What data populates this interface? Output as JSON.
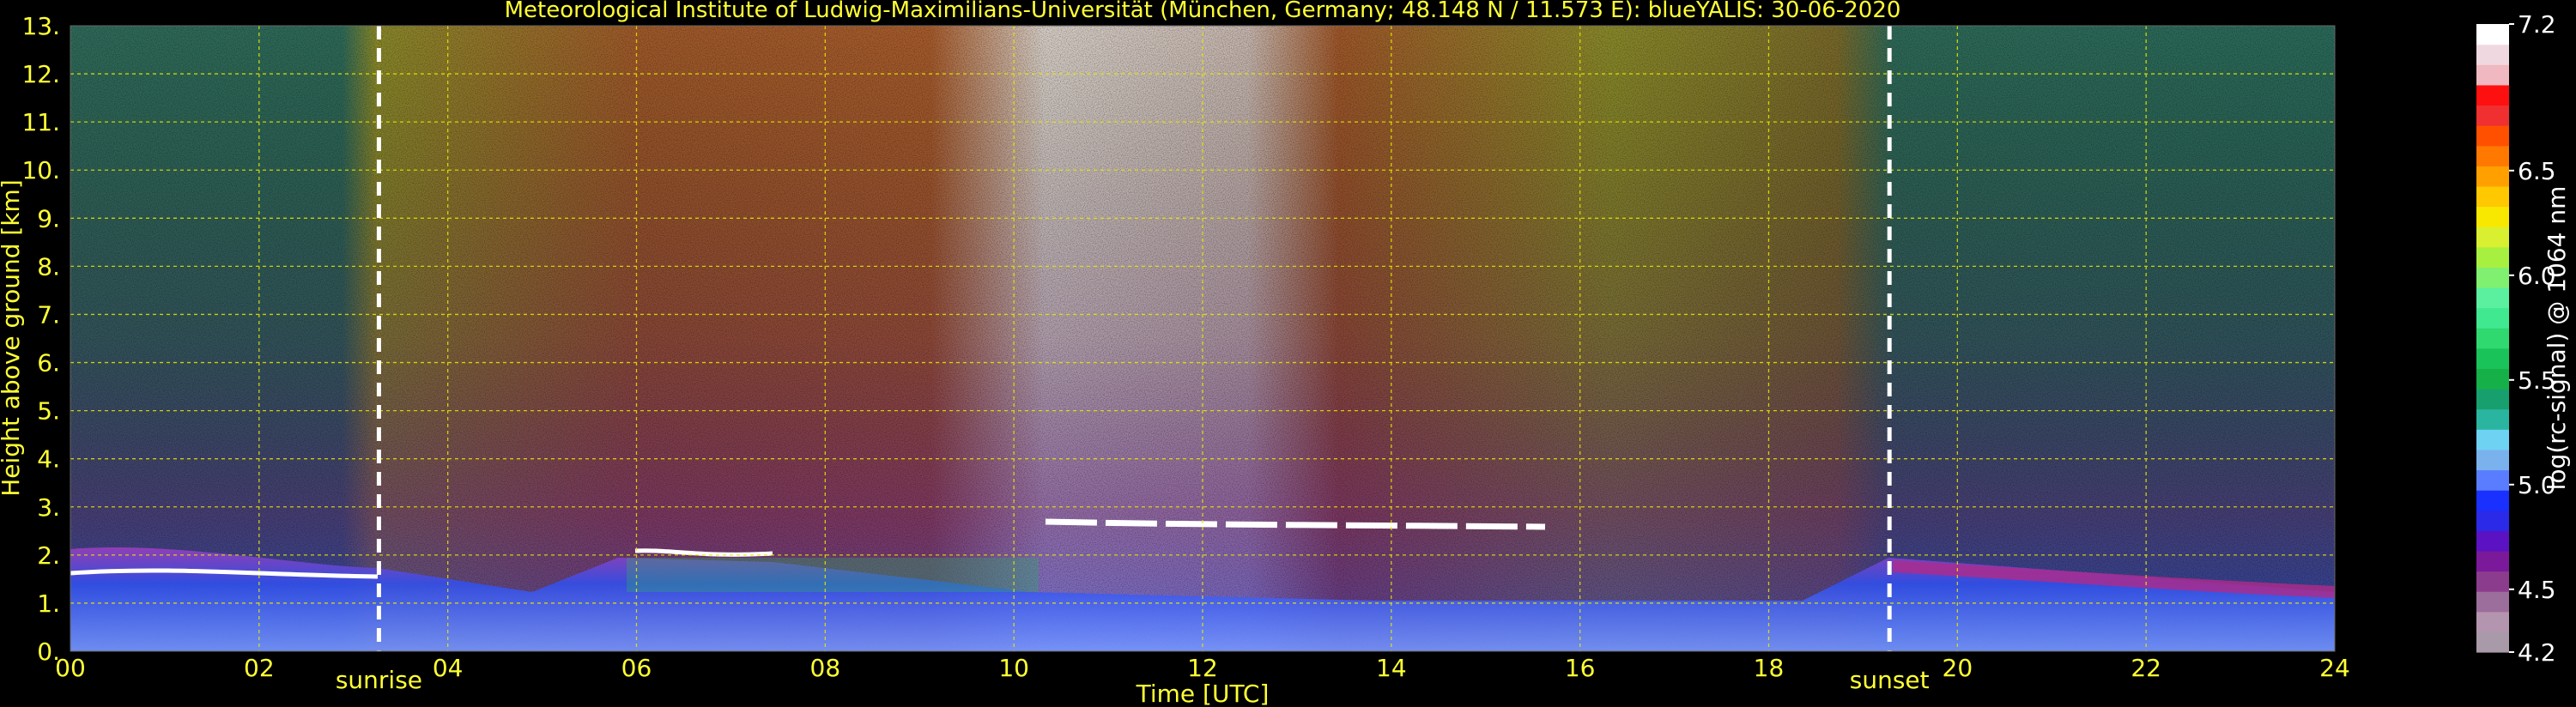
{
  "chart_data": {
    "type": "heatmap",
    "title": "Meteorological Institute of Ludwig-Maximilians-Universität (München, Germany; 48.148 N / 11.573 E):    blueYALIS: 30-06-2020",
    "xlabel": "Time [UTC]",
    "ylabel": "Height above ground [km]",
    "xlim": [
      0,
      24
    ],
    "ylim": [
      0,
      13
    ],
    "x_ticks": [
      "00",
      "02",
      "04",
      "06",
      "08",
      "10",
      "12",
      "14",
      "16",
      "18",
      "20",
      "22",
      "24"
    ],
    "y_ticks": [
      "0.",
      "1.",
      "2.",
      "3.",
      "4.",
      "5.",
      "6.",
      "7.",
      "8.",
      "9.",
      "10.",
      "11.",
      "12.",
      "13."
    ],
    "grid": true,
    "vlines": [
      {
        "x": 3.27,
        "label": "sunrise"
      },
      {
        "x": 19.28,
        "label": "sunset"
      }
    ],
    "colorbar": {
      "label": "log(rc-signal) @ 1064 nm",
      "range": [
        4.2,
        7.2
      ],
      "ticks": [
        "4.2",
        "4.5",
        "5.0",
        "5.5",
        "6.0",
        "6.5",
        "7.2"
      ],
      "colors": [
        "#a89aa8",
        "#b495b0",
        "#9c6e9c",
        "#8c3c8c",
        "#7a1a9a",
        "#5a12c2",
        "#2a2ae8",
        "#1a30ff",
        "#5a7dff",
        "#7ab2ee",
        "#6ed2f2",
        "#2ab5a0",
        "#17a06e",
        "#16b048",
        "#1ac25a",
        "#30d870",
        "#40e890",
        "#5af0a0",
        "#80f070",
        "#a8f040",
        "#d8f030",
        "#f8e800",
        "#ffc800",
        "#ffa000",
        "#ff7800",
        "#ff5000",
        "#f03030",
        "#ff1010",
        "#f0b8c0",
        "#f0d8e0",
        "#ffffff"
      ]
    }
  },
  "colors": {
    "text_yellow": "#ffff33",
    "grid_yellow": "#e8e800",
    "background": "#000000"
  }
}
